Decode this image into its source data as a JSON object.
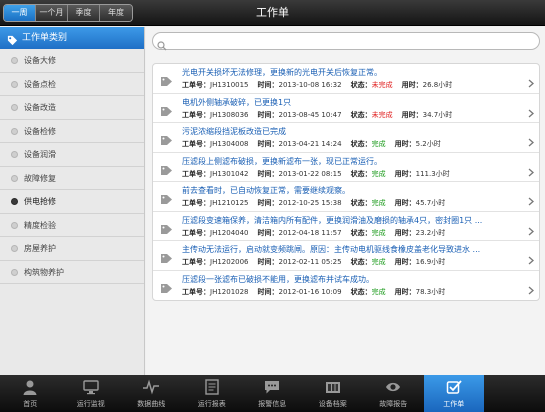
{
  "header": {
    "title": "工作单",
    "periods": [
      "一周",
      "一个月",
      "季度",
      "年度"
    ],
    "active_period": 0
  },
  "sidebar": {
    "header": "工作单类别",
    "selected_index": 6,
    "items": [
      {
        "label": "设备大修"
      },
      {
        "label": "设备点检"
      },
      {
        "label": "设备改造"
      },
      {
        "label": "设备检修"
      },
      {
        "label": "设备润滑"
      },
      {
        "label": "故障修复"
      },
      {
        "label": "供电抢修"
      },
      {
        "label": "精度检验"
      },
      {
        "label": "房屋养护"
      },
      {
        "label": "构筑物养护"
      }
    ]
  },
  "search": {
    "placeholder": "",
    "value": ""
  },
  "labels": {
    "number": "工单号：",
    "time": "时间：",
    "status": "状态：",
    "duration": "用时："
  },
  "colors": {
    "accent": "#1f6fc6",
    "link": "#1a5fb4",
    "status_unfinished": "#e02020",
    "status_done": "#1a9a1a"
  },
  "orders": [
    {
      "title": "光电开关损坏无法修理，更换新的光电开关后恢复正常。",
      "number": "JH1310015",
      "time": "2013-10-08 16:32",
      "status": "未完成",
      "status_type": "red",
      "duration": "26.8小时"
    },
    {
      "title": "电机外侧轴承破碎，已更换1只",
      "number": "JH1308036",
      "time": "2013-08-45 10:47",
      "status": "未完成",
      "status_type": "red",
      "duration": "34.7小时"
    },
    {
      "title": "污泥浓缩段挡泥板改造已完成",
      "number": "JH1304008",
      "time": "2013-04-21 14:24",
      "status": "完成",
      "status_type": "green",
      "duration": "5.2小时"
    },
    {
      "title": "压滤段上侧滤布破损，更换新滤布一张，现已正常运行。",
      "number": "JH1301042",
      "time": "2013-01-22 08:15",
      "status": "完成",
      "status_type": "green",
      "duration": "111.3小时"
    },
    {
      "title": "前去查看时，已自动恢复正常，需要继续观察。",
      "number": "JH1210125",
      "time": "2012-10-25 15:38",
      "status": "完成",
      "status_type": "green",
      "duration": "45.7小时"
    },
    {
      "title": "压滤段变速箱保养，清洁箱内所有配件，更换润滑油及磨损的轴承4只，密封圈1只 ...",
      "number": "JH1204040",
      "time": "2012-04-18 11:57",
      "status": "完成",
      "status_type": "green",
      "duration": "23.2小时"
    },
    {
      "title": "主传动无法运行，启动就变频跳闸。原因：主传动电机驱线食橡皮盖老化导致进水 ...",
      "number": "JH1202006",
      "time": "2012-02-11 05:25",
      "status": "完成",
      "status_type": "green",
      "duration": "16.9小时"
    },
    {
      "title": "压滤段一张滤布已破损不能用，更换滤布并试车成功。",
      "number": "JH1201028",
      "time": "2012-01-16 10:09",
      "status": "完成",
      "status_type": "green",
      "duration": "78.3小时"
    }
  ],
  "tabs": [
    {
      "label": "首页",
      "icon": "user-icon"
    },
    {
      "label": "运行监视",
      "icon": "monitor-icon"
    },
    {
      "label": "数据曲线",
      "icon": "pulse-icon"
    },
    {
      "label": "运行报表",
      "icon": "report-icon"
    },
    {
      "label": "报警信息",
      "icon": "chat-icon"
    },
    {
      "label": "设备档案",
      "icon": "archive-icon"
    },
    {
      "label": "故障报告",
      "icon": "eye-icon"
    },
    {
      "label": "工作单",
      "icon": "checkbox-icon"
    }
  ],
  "active_tab": 7
}
